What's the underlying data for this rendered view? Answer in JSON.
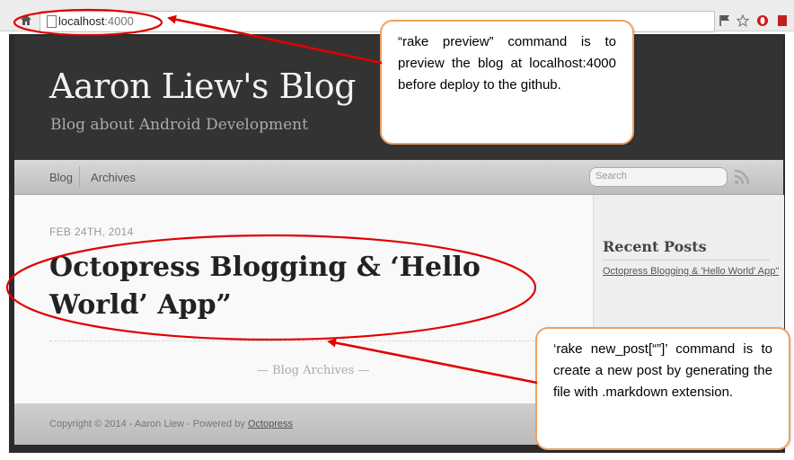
{
  "browser": {
    "url_host": "localhost",
    "url_port": ":4000"
  },
  "blog": {
    "title": "Aaron Liew's Blog",
    "subtitle": "Blog about Android Development",
    "nav": {
      "blog": "Blog",
      "archives": "Archives"
    },
    "search_placeholder": "Search",
    "post": {
      "date": "FEB 24TH, 2014",
      "title": "Octopress Blogging & ‘Hello World’ App”"
    },
    "archives_link": "— Blog Archives —",
    "sidebar": {
      "heading": "Recent Posts",
      "items": [
        "Octopress Blogging & 'Hello World' App\""
      ]
    },
    "footer": {
      "text": "Copyright © 2014 - Aaron Liew - Powered by ",
      "link": "Octopress"
    }
  },
  "annotations": {
    "preview_note": "“rake preview” command is to preview the blog at localhost:4000 before deploy to the github.",
    "new_post_note": "‘rake new_post[“”]’ command is to create a new post by generating the file with .markdown extension."
  },
  "colors": {
    "annotation_red": "#e00000",
    "callout_border": "#f0a060",
    "header_bg": "#333333"
  }
}
